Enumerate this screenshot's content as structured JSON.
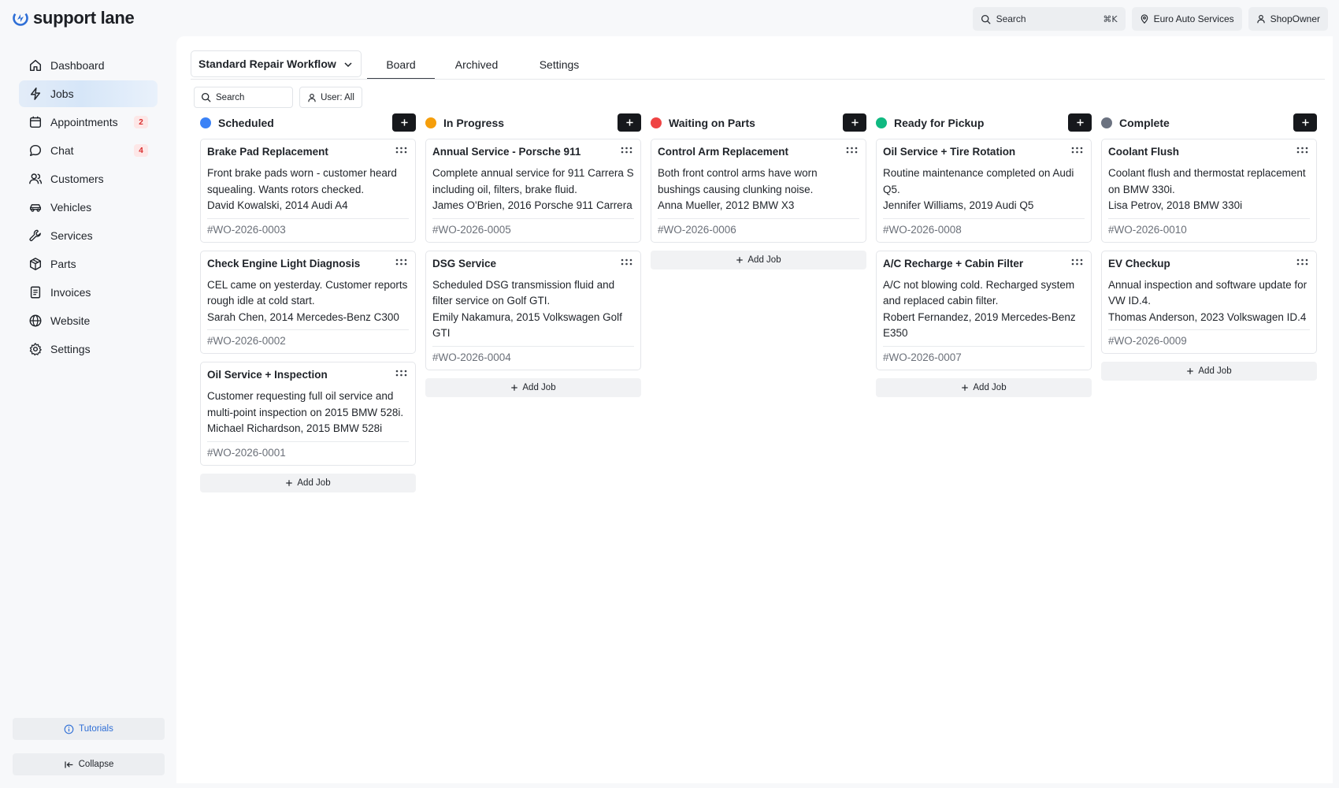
{
  "app": {
    "logo_text": "support lane",
    "brand_color": "#2f6fd6"
  },
  "topbar": {
    "search_label": "Search",
    "search_shortcut": "⌘K",
    "location": "Euro Auto Services",
    "user": "ShopOwner"
  },
  "sidebar": {
    "items": [
      {
        "label": "Dashboard",
        "icon": "home-icon"
      },
      {
        "label": "Jobs",
        "icon": "lightning-icon",
        "active": true
      },
      {
        "label": "Appointments",
        "icon": "calendar-icon",
        "badge": "2"
      },
      {
        "label": "Chat",
        "icon": "chat-icon",
        "badge": "4"
      },
      {
        "label": "Customers",
        "icon": "users-icon"
      },
      {
        "label": "Vehicles",
        "icon": "car-icon"
      },
      {
        "label": "Services",
        "icon": "wrench-icon"
      },
      {
        "label": "Parts",
        "icon": "package-icon"
      },
      {
        "label": "Invoices",
        "icon": "receipt-icon"
      },
      {
        "label": "Website",
        "icon": "globe-icon"
      },
      {
        "label": "Settings",
        "icon": "gear-icon"
      }
    ],
    "tutorials_label": "Tutorials",
    "collapse_label": "Collapse"
  },
  "main": {
    "workflow_select": "Standard Repair Workflow",
    "tabs": [
      {
        "label": "Board",
        "active": true
      },
      {
        "label": "Archived"
      },
      {
        "label": "Settings"
      }
    ],
    "search_placeholder": "Search",
    "user_filter": "User: All",
    "add_job_label": "Add Job"
  },
  "columns": [
    {
      "title": "Scheduled",
      "color": "#3b82f6",
      "cards": [
        {
          "title": "Brake Pad Replacement",
          "desc": "Front brake pads worn - customer heard squealing. Wants rotors checked.",
          "customer": "David Kowalski, 2014 Audi A4",
          "id": "#WO-2026-0003"
        },
        {
          "title": "Check Engine Light Diagnosis",
          "desc": "CEL came on yesterday. Customer reports rough idle at cold start.",
          "customer": "Sarah Chen, 2014 Mercedes-Benz C300",
          "id": "#WO-2026-0002"
        },
        {
          "title": "Oil Service + Inspection",
          "desc": "Customer requesting full oil service and multi-point inspection on 2015 BMW 528i.",
          "customer": "Michael Richardson, 2015 BMW 528i",
          "id": "#WO-2026-0001"
        }
      ]
    },
    {
      "title": "In Progress",
      "color": "#f59e0b",
      "cards": [
        {
          "title": "Annual Service - Porsche 911",
          "desc": "Complete annual service for 911 Carrera S including oil, filters, brake fluid.",
          "customer": "James O'Brien, 2016 Porsche 911 Carrera",
          "id": "#WO-2026-0005"
        },
        {
          "title": "DSG Service",
          "desc": "Scheduled DSG transmission fluid and filter service on Golf GTI.",
          "customer": "Emily Nakamura, 2015 Volkswagen Golf GTI",
          "id": "#WO-2026-0004"
        }
      ]
    },
    {
      "title": "Waiting on Parts",
      "color": "#ef4444",
      "cards": [
        {
          "title": "Control Arm Replacement",
          "desc": "Both front control arms have worn bushings causing clunking noise.",
          "customer": "Anna Mueller, 2012 BMW X3",
          "id": "#WO-2026-0006"
        }
      ]
    },
    {
      "title": "Ready for Pickup",
      "color": "#10b981",
      "cards": [
        {
          "title": "Oil Service + Tire Rotation",
          "desc": "Routine maintenance completed on Audi Q5.",
          "customer": "Jennifer Williams, 2019 Audi Q5",
          "id": "#WO-2026-0008"
        },
        {
          "title": "A/C Recharge + Cabin Filter",
          "desc": "A/C not blowing cold. Recharged system and replaced cabin filter.",
          "customer": "Robert Fernandez, 2019 Mercedes-Benz E350",
          "id": "#WO-2026-0007"
        }
      ]
    },
    {
      "title": "Complete",
      "color": "#6b7280",
      "cards": [
        {
          "title": "Coolant Flush",
          "desc": "Coolant flush and thermostat replacement on BMW 330i.",
          "customer": "Lisa Petrov, 2018 BMW 330i",
          "id": "#WO-2026-0010"
        },
        {
          "title": "EV Checkup",
          "desc": "Annual inspection and software update for VW ID.4.",
          "customer": "Thomas Anderson, 2023 Volkswagen ID.4",
          "id": "#WO-2026-0009"
        }
      ]
    }
  ]
}
